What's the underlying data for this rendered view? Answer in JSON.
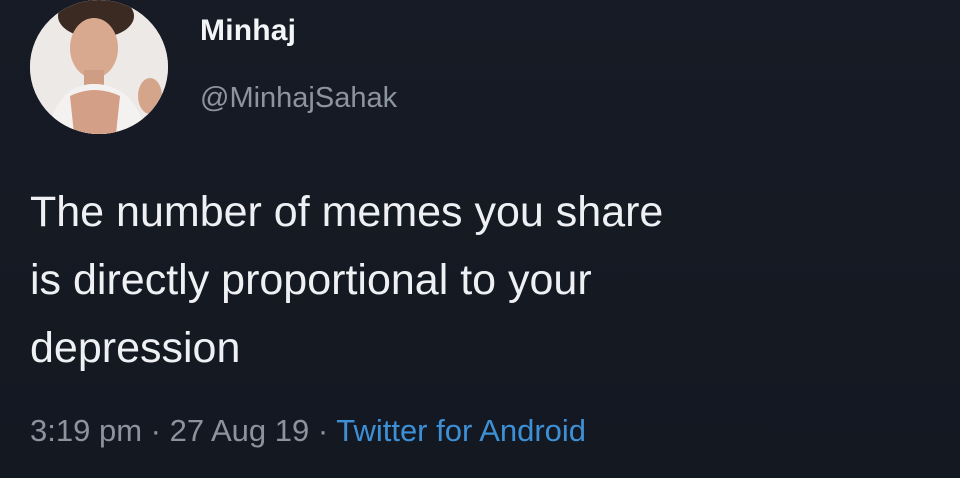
{
  "tweet": {
    "author": {
      "display_name": "Minhaj",
      "handle": "@MinhajSahak",
      "avatar_icon": "profile-photo"
    },
    "text": "The number of memes you share\nis directly proportional to your\ndepression",
    "time": "3:19 pm",
    "separator": " · ",
    "date": "27 Aug 19",
    "source": "Twitter for Android"
  },
  "colors": {
    "background": "#161a23",
    "text": "#eef0f3",
    "muted": "#8b939e",
    "link": "#3d8fd6"
  }
}
